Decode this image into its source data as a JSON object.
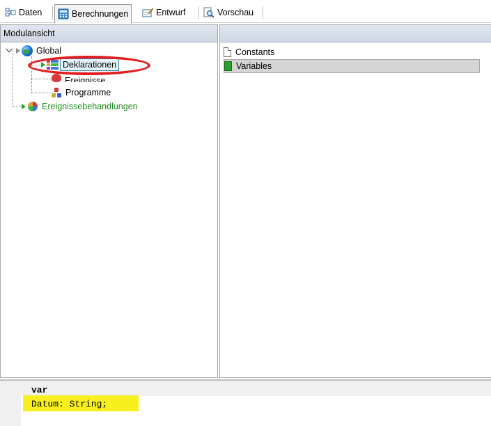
{
  "tabs": [
    {
      "label": "Daten",
      "icon": "data-icon"
    },
    {
      "label": "Berechnungen",
      "icon": "calculator-icon",
      "active": true
    },
    {
      "label": "Entwurf",
      "icon": "design-pencil-icon"
    },
    {
      "label": "Vorschau",
      "icon": "preview-magnifier-icon"
    }
  ],
  "left_panel": {
    "header": "Modulansicht",
    "tree": {
      "global": "Global",
      "deklarationen": "Deklarationen",
      "ereignisse": "Ereignisse",
      "programme": "Programme",
      "ereignisbehandlungen": "Ereignissebehandlungen"
    }
  },
  "right_panel": {
    "header": "",
    "items": [
      {
        "label": "Constants",
        "icon": "document-icon",
        "selected": false
      },
      {
        "label": "Variables",
        "icon": "green-document-icon",
        "selected": true
      }
    ]
  },
  "editor": {
    "lines": [
      "var",
      "Datum: String;"
    ]
  },
  "colors": {
    "annotation_circle": "#e02020",
    "highlight": "#f7f01e",
    "tree_green_text": "#1f8a1f"
  }
}
